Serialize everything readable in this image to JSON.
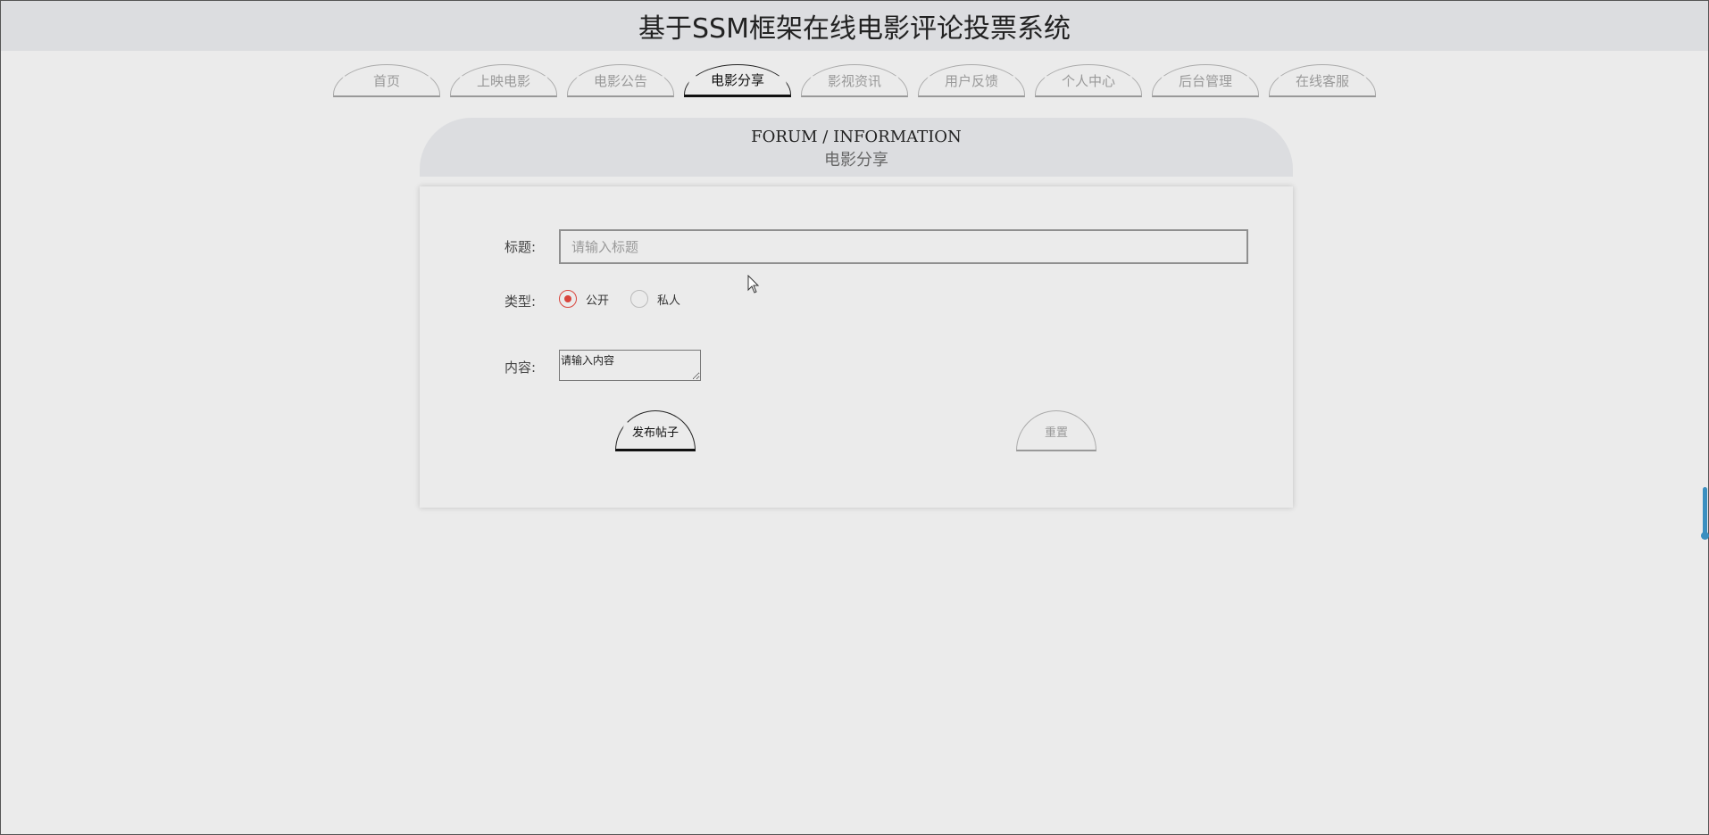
{
  "header": {
    "title": "基于SSM框架在线电影评论投票系统"
  },
  "nav": {
    "items": [
      {
        "label": "首页"
      },
      {
        "label": "上映电影"
      },
      {
        "label": "电影公告"
      },
      {
        "label": "电影分享"
      },
      {
        "label": "影视资讯"
      },
      {
        "label": "用户反馈"
      },
      {
        "label": "个人中心"
      },
      {
        "label": "后台管理"
      },
      {
        "label": "在线客服"
      }
    ],
    "active": "电影分享"
  },
  "section": {
    "title_en": "FORUM / INFORMATION",
    "title_cn": "电影分享"
  },
  "form": {
    "title_label": "标题:",
    "title_placeholder": "请输入标题",
    "title_value": "",
    "type_label": "类型:",
    "type_options": [
      {
        "label": "公开",
        "checked": true
      },
      {
        "label": "私人",
        "checked": false
      }
    ],
    "content_label": "内容:",
    "content_placeholder": "请输入内容",
    "submit_label": "发布帖子",
    "reset_label": "重置"
  },
  "colors": {
    "background": "#ebebeb",
    "header_bg": "#dcdde0",
    "radio_checked": "#d9453d",
    "scroll_accent": "#3a8fc0"
  }
}
